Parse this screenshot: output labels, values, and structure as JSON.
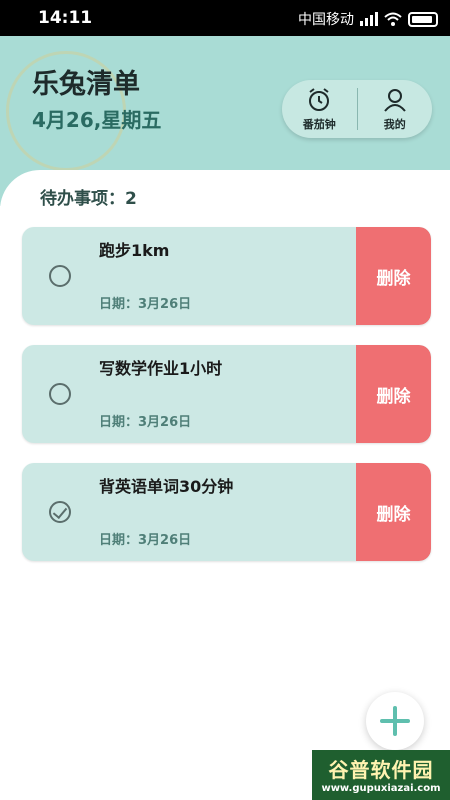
{
  "status": {
    "time": "14:11",
    "carrier": "中国移动"
  },
  "header": {
    "title": "乐兔清单",
    "date": "4月26,星期五",
    "actions": [
      {
        "label": "番茄钟",
        "icon": "alarm-clock-icon"
      },
      {
        "label": "我的",
        "icon": "user-icon"
      }
    ]
  },
  "todo": {
    "count_label": "待办事项：2"
  },
  "tasks": [
    {
      "name": "跑步1km",
      "date": "日期：3月26日",
      "done": false,
      "delete_label": "删除"
    },
    {
      "name": "写数学作业1小时",
      "date": "日期：3月26日",
      "done": false,
      "delete_label": "删除"
    },
    {
      "name": "背英语单词30分钟",
      "date": "日期：3月26日",
      "done": true,
      "delete_label": "删除"
    }
  ],
  "colors": {
    "header_bg": "#a9dcd5",
    "card_bg": "#cce8e4",
    "delete_bg": "#ef6f72",
    "accent": "#5fbfae"
  },
  "watermark": {
    "title": "谷普软件园",
    "url": "www.gupuxiazai.com"
  }
}
